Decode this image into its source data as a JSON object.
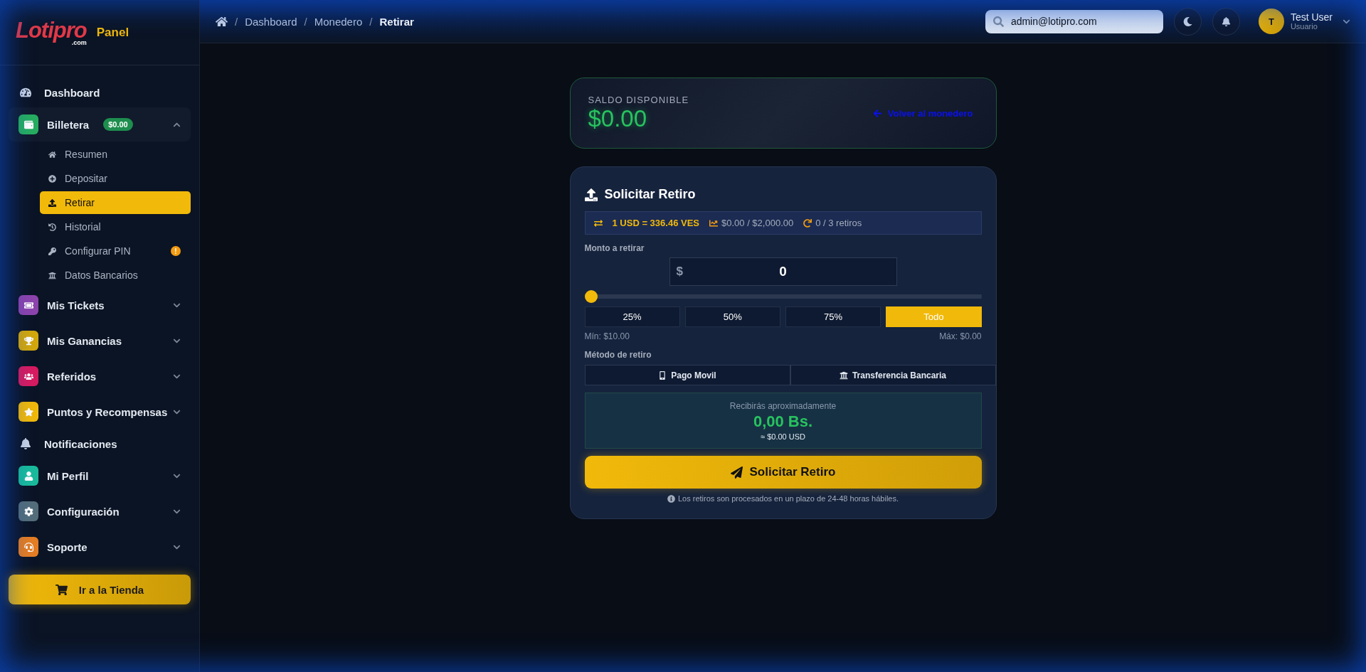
{
  "logo": {
    "brand": "Lotipro",
    "domain": ".com",
    "suffix": "Panel"
  },
  "sidebar": {
    "items": [
      {
        "kind": "plain",
        "label": "Dashboard"
      },
      {
        "kind": "group",
        "label": "Billetera",
        "color": "#27ae60",
        "badge": "$0.00",
        "expanded": true,
        "children": [
          {
            "label": "Resumen",
            "selected": false
          },
          {
            "label": "Depositar",
            "selected": false
          },
          {
            "label": "Retirar",
            "selected": true
          },
          {
            "label": "Historial",
            "selected": false
          },
          {
            "label": "Configurar PIN",
            "selected": false,
            "alert": "!"
          },
          {
            "label": "Datos Bancarios",
            "selected": false
          }
        ]
      },
      {
        "kind": "group",
        "label": "Mis Tickets",
        "color": "#8e44ad",
        "expanded": false
      },
      {
        "kind": "group",
        "label": "Mis Ganancias",
        "color": "#d4a80c",
        "expanded": false
      },
      {
        "kind": "group",
        "label": "Referidos",
        "color": "#d81b60",
        "expanded": false
      },
      {
        "kind": "group",
        "label": "Puntos y Recompensas",
        "color": "#f1b90a",
        "expanded": false
      },
      {
        "kind": "plain",
        "label": "Notificaciones"
      },
      {
        "kind": "group",
        "label": "Mi Perfil",
        "color": "#1abc9c",
        "expanded": false
      },
      {
        "kind": "group",
        "label": "Configuración",
        "color": "#546e7a",
        "expanded": false
      },
      {
        "kind": "group",
        "label": "Soporte",
        "color": "#e67e22",
        "expanded": false
      }
    ],
    "store_button": "Ir a la Tienda"
  },
  "breadcrumb": {
    "separator": "/",
    "items": [
      "Dashboard",
      "Monedero",
      "Retirar"
    ]
  },
  "header": {
    "search": {
      "value": "admin@lotipro.com"
    },
    "user": {
      "initial": "T",
      "name": "Test User",
      "role": "Usuario"
    }
  },
  "balance": {
    "label": "SALDO DISPONIBLE",
    "amount": "$0.00",
    "back_link": "Volver al monedero"
  },
  "form": {
    "title": "Solicitar Retiro",
    "stats": {
      "rate": "1 USD = 336.46 VES",
      "limit": "$0.00 / $2,000.00",
      "count": "0 / 3 retiros"
    },
    "amount_label": "Monto a retirar",
    "currency": "$",
    "amount": "0",
    "slider": {
      "level": 0
    },
    "presets": [
      {
        "label": "25%",
        "selected": false
      },
      {
        "label": "50%",
        "selected": false
      },
      {
        "label": "75%",
        "selected": false
      },
      {
        "label": "Todo",
        "selected": true
      }
    ],
    "min": "Mín: $10.00",
    "max": "Máx: $0.00",
    "method_label": "Método de retiro",
    "methods": [
      {
        "label": "Pago Movil",
        "selected": false
      },
      {
        "label": "Transferencia Bancaria",
        "selected": false
      }
    ],
    "estimate": {
      "label": "Recibirás aproximadamente",
      "value": "0,00 Bs.",
      "usd": "≈ $0.00 USD"
    },
    "submit": "Solicitar Retiro",
    "note": "Los retiros son procesados en un plazo de 24-48 horas hábiles."
  }
}
